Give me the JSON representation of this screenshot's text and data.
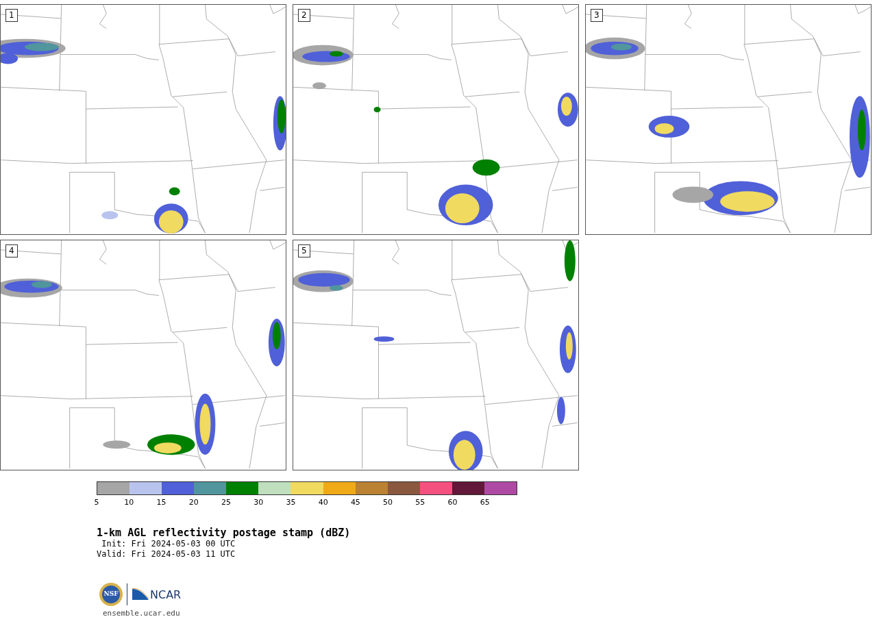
{
  "panels": [
    {
      "label": "1"
    },
    {
      "label": "2"
    },
    {
      "label": "3"
    },
    {
      "label": "4"
    },
    {
      "label": "5"
    }
  ],
  "colorbar": {
    "bins": [
      {
        "color": "#a6a6a6"
      },
      {
        "color": "#b8c4ee"
      },
      {
        "color": "#5060d8"
      },
      {
        "color": "#50969c"
      },
      {
        "color": "#008000"
      },
      {
        "color": "#bfdfbf"
      },
      {
        "color": "#f0da60"
      },
      {
        "color": "#f0aa18"
      },
      {
        "color": "#ba8232"
      },
      {
        "color": "#8a583e"
      },
      {
        "color": "#f45080"
      },
      {
        "color": "#621838"
      },
      {
        "color": "#ae4aa4"
      }
    ],
    "ticks": [
      "5",
      "10",
      "15",
      "20",
      "25",
      "30",
      "35",
      "40",
      "45",
      "50",
      "55",
      "60",
      "65"
    ]
  },
  "title": "1-km AGL reflectivity postage stamp (dBZ)",
  "init": " Init: Fri 2024-05-03 00 UTC",
  "valid": "Valid: Fri 2024-05-03 11 UTC",
  "logos": {
    "nsf": "NSF",
    "ncar": "NCAR"
  },
  "url": "ensemble.ucar.edu"
}
